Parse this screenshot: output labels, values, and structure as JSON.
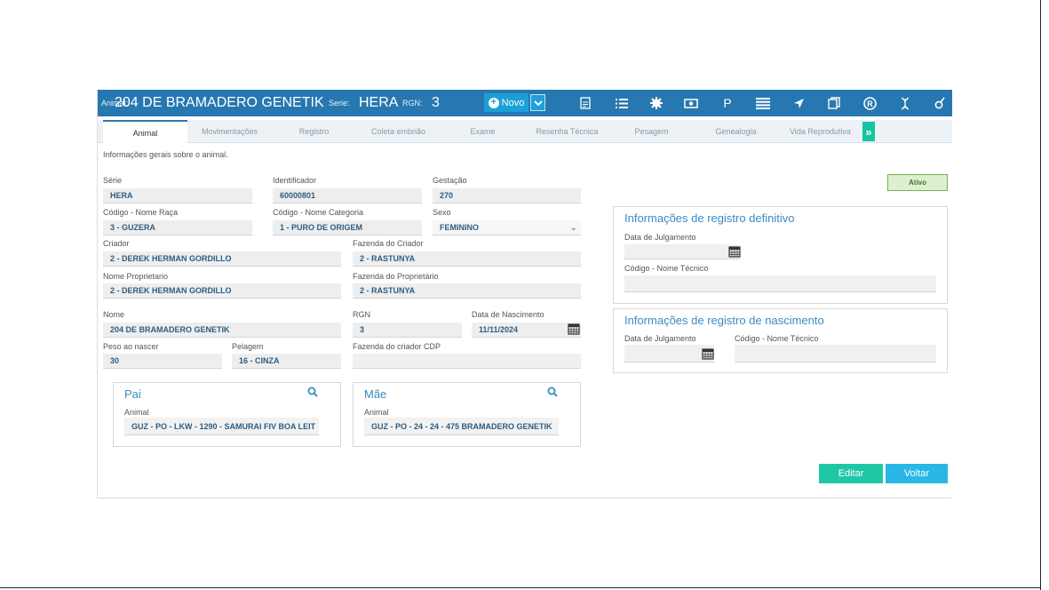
{
  "header": {
    "animal_label": "Animal:",
    "animal_value": "204 DE BRAMADERO GENETIK",
    "serie_label": "Serie:",
    "serie_value": "HERA",
    "rgn_label": "RGN:",
    "rgn_value": "3",
    "novo_label": "Novo",
    "icons": [
      "document-icon",
      "list-icon",
      "gear-icon",
      "money-icon",
      "p-icon",
      "menu-icon",
      "location-icon",
      "copy-icon",
      "registered-icon",
      "dna-icon",
      "syringe-icon"
    ],
    "p_label": "P"
  },
  "tabs": [
    {
      "label": "Animal",
      "active": true
    },
    {
      "label": "Movimentações"
    },
    {
      "label": "Registro"
    },
    {
      "label": "Coleta embrião"
    },
    {
      "label": "Exame"
    },
    {
      "label": "Resenha Técnica"
    },
    {
      "label": "Pesagem"
    },
    {
      "label": "Genealogia"
    },
    {
      "label": "Vida Reprodutiva"
    }
  ],
  "info_text": "Informações gerais sobre o animal.",
  "status": "Ativo",
  "form": {
    "serie": {
      "label": "Série",
      "value": "HERA"
    },
    "identificador": {
      "label": "Identificador",
      "value": "60000801"
    },
    "gestacao": {
      "label": "Gestação",
      "value": "270"
    },
    "raca": {
      "label": "Código - Nome Raça",
      "value": "3 - GUZERA"
    },
    "categoria": {
      "label": "Código - Nome Categoria",
      "value": "1 - PURO DE ORIGEM"
    },
    "sexo": {
      "label": "Sexo",
      "value": "FEMININO"
    },
    "criador": {
      "label": "Criador",
      "value": "2 - DEREK HERMAN GORDILLO"
    },
    "fazenda_criador": {
      "label": "Fazenda do Criador",
      "value": "2 - RASTUNYA"
    },
    "proprietario": {
      "label": "Nome Proprietario",
      "value": "2 - DEREK HERMAN GORDILLO"
    },
    "fazenda_proprietario": {
      "label": "Fazenda do Proprietário",
      "value": "2 - RASTUNYA"
    },
    "nome": {
      "label": "Nome",
      "value": "204 DE BRAMADERO GENETIK"
    },
    "rgn": {
      "label": "RGN",
      "value": "3"
    },
    "nascimento": {
      "label": "Data de Nascimento",
      "value": "11/11/2024"
    },
    "peso": {
      "label": "Peso ao nascer",
      "value": "30"
    },
    "pelagem": {
      "label": "Pelagem",
      "value": "16 - CINZA"
    },
    "fazenda_cdp": {
      "label": "Fazenda do criador CDP",
      "value": ""
    }
  },
  "pai": {
    "title": "Pai",
    "animal_label": "Animal",
    "value": "GUZ - PO - LKW - 1290 - SAMURAI FIV BOA LEIT"
  },
  "mae": {
    "title": "Mãe",
    "animal_label": "Animal",
    "value": "GUZ - PO - 24 - 24 - 475 BRAMADERO GENETIK"
  },
  "registro_definitivo": {
    "title": "Informações de registro definitivo",
    "data_label": "Data de Julgamento",
    "tecnico_label": "Código - Nome Técnico"
  },
  "registro_nascimento": {
    "title": "Informações de registro de nascimento",
    "data_label": "Data de Julgamento",
    "tecnico_label": "Código - Nome Técnico"
  },
  "buttons": {
    "edit": "Editar",
    "back": "Voltar"
  }
}
